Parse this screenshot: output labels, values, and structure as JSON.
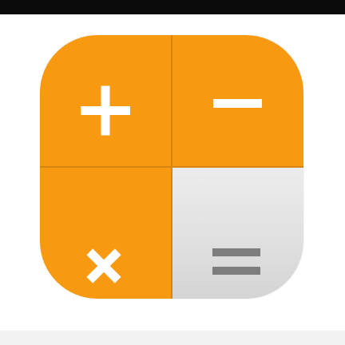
{
  "icon": {
    "name": "calculator-app-icon",
    "colors": {
      "accent": "#f79a12",
      "divider": "#d88412",
      "gray_key": "#e3e3e3",
      "symbol_light": "#ffffff",
      "symbol_dark": "#7d7d7d",
      "top_bar": "#0a0a0a",
      "bottom_strip": "#f2f2f2"
    },
    "keys": [
      {
        "symbol": "plus-icon"
      },
      {
        "symbol": "minus-icon"
      },
      {
        "symbol": "times-icon"
      },
      {
        "symbol": "equals-icon"
      }
    ]
  }
}
